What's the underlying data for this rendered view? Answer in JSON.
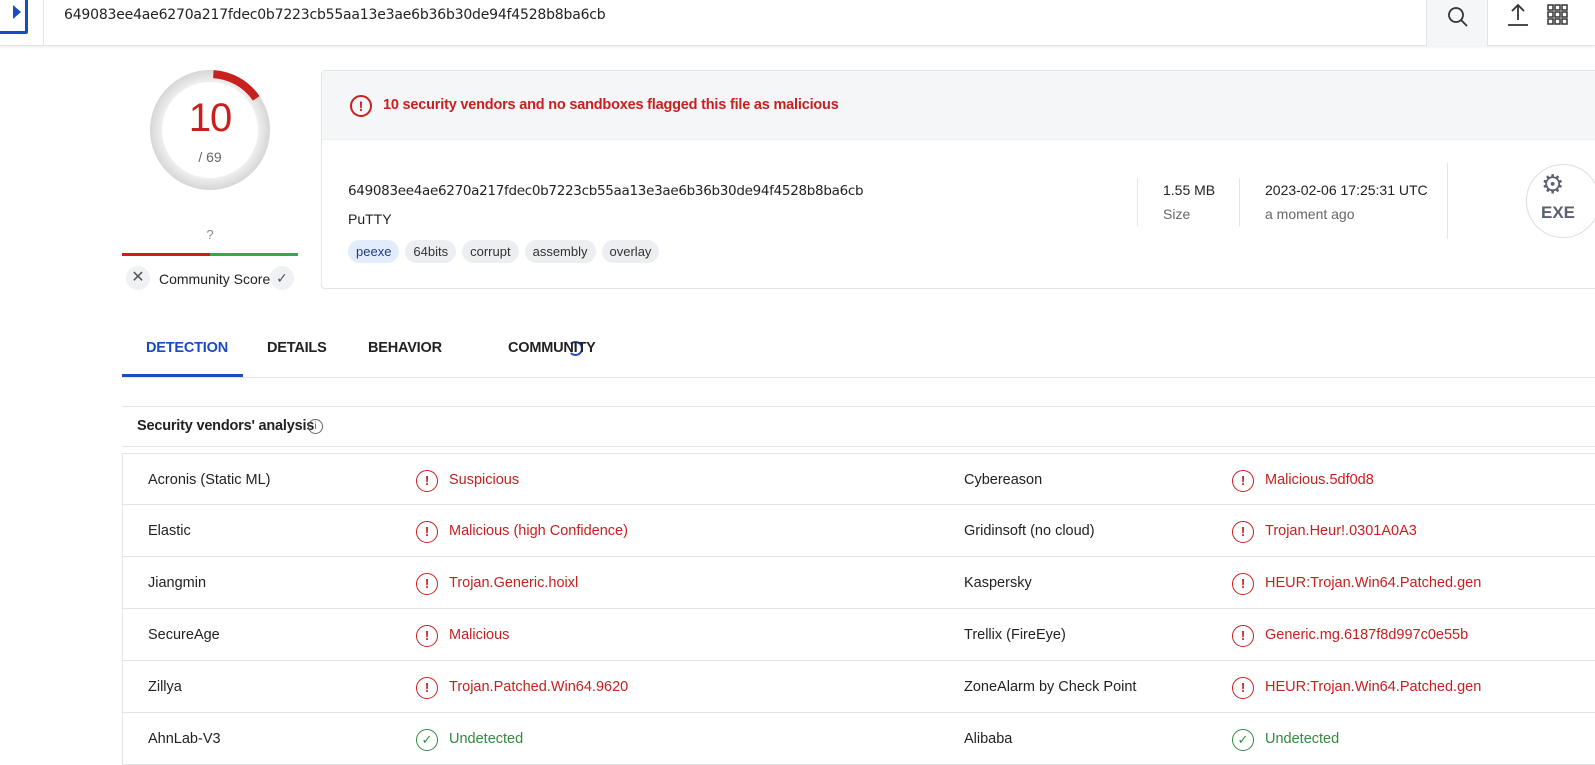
{
  "topbar": {
    "search_value": "649083ee4ae6270a217fdec0b7223cb55aa13e3ae6b36b30de94f4528b8ba6cb"
  },
  "score": {
    "detections": "10",
    "total": "/ 69",
    "fraction_flagged": 0.145
  },
  "community": {
    "score": "?",
    "label": "Community Score"
  },
  "summary": {
    "alert": "10 security vendors and no sandboxes flagged this file as malicious",
    "hash": "649083ee4ae6270a217fdec0b7223cb55aa13e3ae6b36b30de94f4528b8ba6cb",
    "file_name": "PuTTY",
    "tags": [
      "peexe",
      "64bits",
      "corrupt",
      "assembly",
      "overlay"
    ],
    "size_value": "1.55 MB",
    "size_label": "Size",
    "date_value": "2023-02-06 17:25:31 UTC",
    "date_label": "a moment ago",
    "file_type_icon": "EXE"
  },
  "tabs": [
    {
      "label": "DETECTION"
    },
    {
      "label": "DETAILS"
    },
    {
      "label": "BEHAVIOR"
    },
    {
      "label": "COMMUNITY"
    }
  ],
  "vendors": {
    "title": "Security vendors' analysis",
    "rows": [
      {
        "left_name": "Acronis (Static ML)",
        "left_result": "Suspicious",
        "right_name": "Cybereason",
        "right_result": "Malicious.5df0d8"
      },
      {
        "left_name": "Elastic",
        "left_result": "Malicious (high Confidence)",
        "right_name": "Gridinsoft (no cloud)",
        "right_result": "Trojan.Heur!.0301A0A3"
      },
      {
        "left_name": "Jiangmin",
        "left_result": "Trojan.Generic.hoixl",
        "right_name": "Kaspersky",
        "right_result": "HEUR:Trojan.Win64.Patched.gen"
      },
      {
        "left_name": "SecureAge",
        "left_result": "Malicious",
        "right_name": "Trellix (FireEye)",
        "right_result": "Generic.mg.6187f8d997c0e55b"
      },
      {
        "left_name": "Zillya",
        "left_result": "Trojan.Patched.Win64.9620",
        "right_name": "ZoneAlarm by Check Point",
        "right_result": "HEUR:Trojan.Win64.Patched.gen"
      },
      {
        "left_name": "AhnLab-V3",
        "left_result": "Undetected",
        "right_name": "Alibaba",
        "right_result": "Undetected"
      }
    ]
  },
  "colors": {
    "accent": "#1a4bc4",
    "malicious": "#c8201f",
    "clean": "#2f8a3e"
  }
}
